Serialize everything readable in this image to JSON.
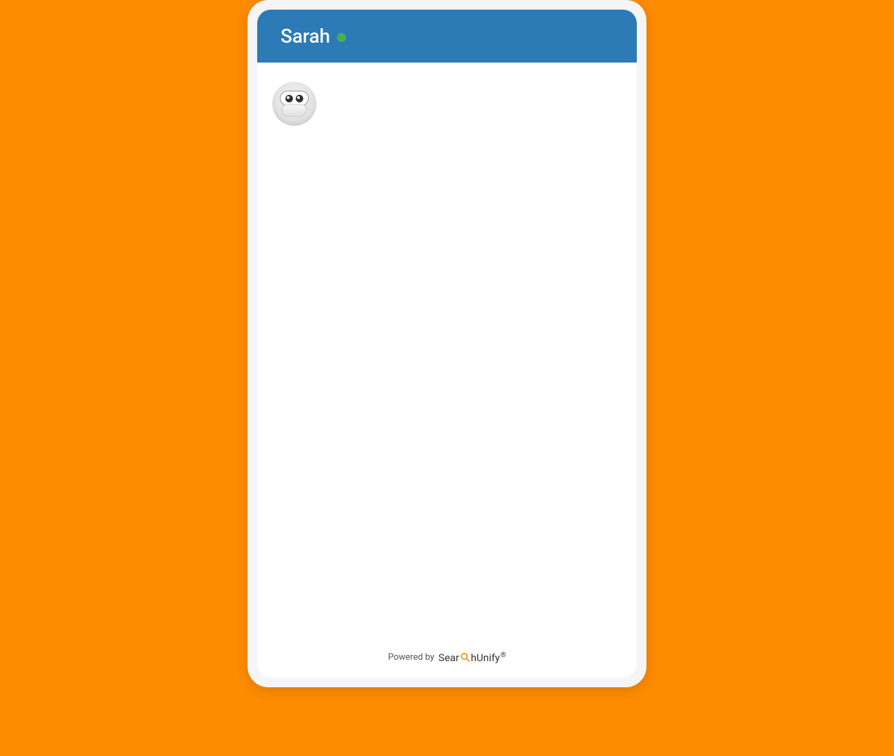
{
  "header": {
    "bot_name": "Sarah",
    "status": "online"
  },
  "footer": {
    "powered_by": "Powered by",
    "brand_part1": "Sear",
    "brand_part2": "hUnify"
  },
  "colors": {
    "background": "#ff8c00",
    "header_bg": "#2c7bb6",
    "status_online": "#4caf50",
    "brand_accent": "#ff8c00"
  }
}
